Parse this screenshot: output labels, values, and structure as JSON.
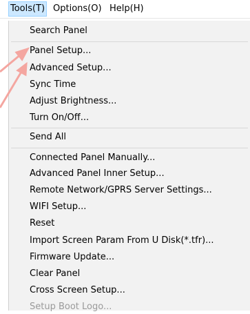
{
  "menubar": {
    "items": [
      {
        "label": "Tools(T)",
        "active": true
      },
      {
        "label": "Options(O)",
        "active": false
      },
      {
        "label": "Help(H)",
        "active": false
      }
    ]
  },
  "tools_menu": {
    "items": [
      {
        "label": "Search Panel"
      },
      {
        "label": "Panel Setup..."
      },
      {
        "label": "Advanced Setup..."
      },
      {
        "label": "Sync Time"
      },
      {
        "label": "Adjust Brightness..."
      },
      {
        "label": "Turn On/Off..."
      },
      {
        "label": "Send All"
      },
      {
        "label": "Connected Panel Manually..."
      },
      {
        "label": "Advanced Panel Inner Setup..."
      },
      {
        "label": "Remote Network/GPRS Server Settings..."
      },
      {
        "label": "WIFI Setup..."
      },
      {
        "label": "Reset"
      },
      {
        "label": "Import Screen Param From U Disk(*.tfr)..."
      },
      {
        "label": "Firmware Update..."
      },
      {
        "label": "Clear Panel"
      },
      {
        "label": "Cross Screen Setup..."
      },
      {
        "label": "Setup Boot Logo...",
        "enabled": false
      }
    ]
  },
  "annotation": {
    "arrow_color": "#f4a6a0"
  }
}
